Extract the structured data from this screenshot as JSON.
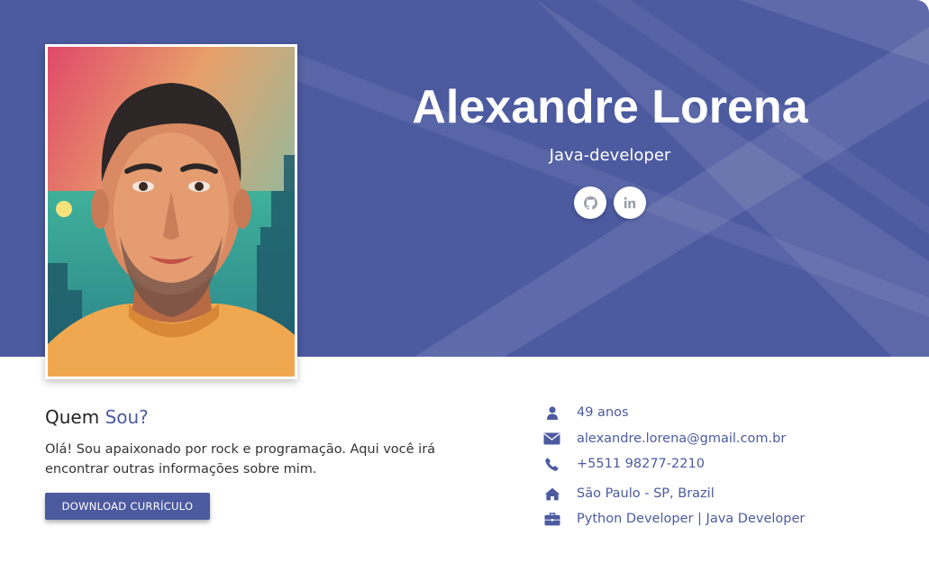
{
  "profile": {
    "name": "Alexandre Lorena",
    "title": "Java-developer"
  },
  "socials": [
    {
      "icon": "github-icon"
    },
    {
      "icon": "linkedin-icon"
    }
  ],
  "about": {
    "heading_prefix": "Quem",
    "heading_accent": "Sou?",
    "text": "Olá! Sou apaixonado por rock e programação. Aqui você irá encontrar outras informações sobre mim.",
    "download_label": "DOWNLOAD CURRÍCULO"
  },
  "info": {
    "age": "49 anos",
    "email": "alexandre.lorena@gmail.com.br",
    "phone": "+5511 98277-2210",
    "location": "São Paulo - SP, Brazil",
    "occupation": "Python Developer | Java Developer"
  },
  "colors": {
    "primary": "#4c5aa0",
    "banner_light": "#6873b0",
    "text_dark": "#222222"
  }
}
